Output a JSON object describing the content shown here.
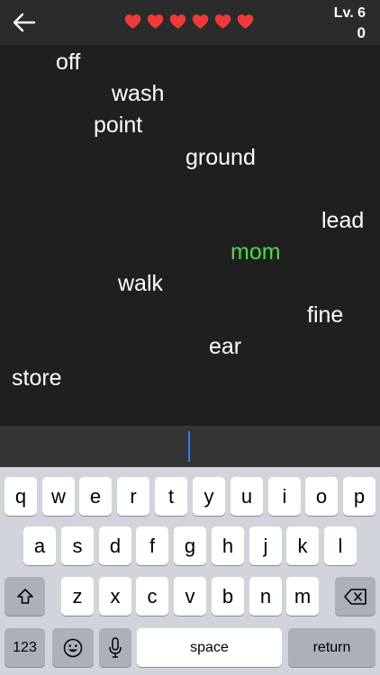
{
  "header": {
    "lives": 6,
    "level": "Lv. 6",
    "score": "0",
    "heart_color": "#ef3a3a"
  },
  "words": [
    {
      "text": "off",
      "active": false
    },
    {
      "text": "wash",
      "active": false
    },
    {
      "text": "point",
      "active": false
    },
    {
      "text": "ground",
      "active": false
    },
    {
      "text": "lead",
      "active": false
    },
    {
      "text": "mom",
      "active": true
    },
    {
      "text": "walk",
      "active": false
    },
    {
      "text": "fine",
      "active": false
    },
    {
      "text": "ear",
      "active": false
    },
    {
      "text": "store",
      "active": false
    }
  ],
  "input": {
    "value": ""
  },
  "keyboard": {
    "row1": [
      "q",
      "w",
      "e",
      "r",
      "t",
      "y",
      "u",
      "i",
      "o",
      "p"
    ],
    "row2": [
      "a",
      "s",
      "d",
      "f",
      "g",
      "h",
      "j",
      "k",
      "l"
    ],
    "row3": [
      "z",
      "x",
      "c",
      "v",
      "b",
      "n",
      "m"
    ],
    "numbers_label": "123",
    "space_label": "space",
    "return_label": "return"
  },
  "colors": {
    "active_word": "#4cd94c",
    "caret": "#2d7cf6"
  }
}
